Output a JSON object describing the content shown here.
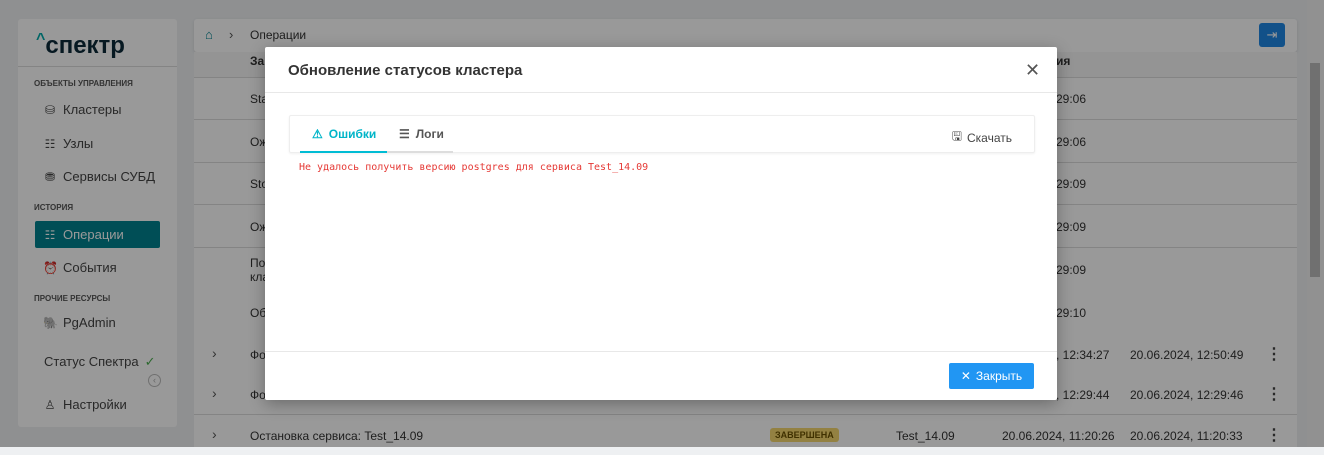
{
  "sidebar": {
    "logo": "спектр",
    "sections": [
      "ОБЪЕКТЫ УПРАВЛЕНИЯ",
      "ИСТОРИЯ",
      "ПРОЧИЕ РЕСУРСЫ"
    ],
    "items": [
      "Кластеры",
      "Узлы",
      "Сервисы СУБД",
      "Операции",
      "События",
      "PgAdmin"
    ],
    "status": "Статус Спектра",
    "status_icon": "✓",
    "settings": "Настройки"
  },
  "topbar": {
    "breadcrumb": "Операции"
  },
  "table": {
    "header_left": "За",
    "header_right": "ия",
    "rows": [
      {
        "left": "Sta",
        "right": "29:06"
      },
      {
        "left": "Ож",
        "right": "29:06"
      },
      {
        "left": "Sto",
        "right": "29:09"
      },
      {
        "left": "Ож",
        "right": "29:09"
      },
      {
        "left": "По",
        "left2": "кла",
        "right": "29:09"
      },
      {
        "left": "Об",
        "right": "29:10"
      },
      {
        "left": "Фо",
        "start": ", 12:34:27",
        "end": "20.06.2024, 12:50:49"
      },
      {
        "left": "Фо",
        "start": ", 12:29:44",
        "end": "20.06.2024, 12:29:46"
      },
      {
        "left": "Остановка сервиса: Test_14.09",
        "status": "ЗАВЕРШЕНА",
        "service": "Test_14.09",
        "start": "20.06.2024, 11:20:26",
        "end": "20.06.2024, 11:20:33"
      }
    ]
  },
  "modal": {
    "title": "Обновление статусов кластера",
    "tabs": [
      "Ошибки",
      "Логи"
    ],
    "download": "Скачать",
    "error": "Не удалось получить версию postgres для сервиса Test_14.09",
    "close": "Закрыть"
  }
}
